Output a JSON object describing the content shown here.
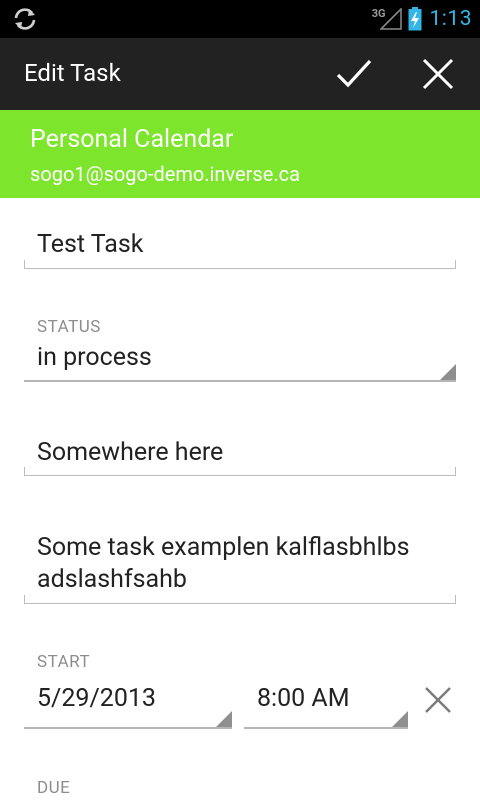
{
  "status_bar": {
    "network_type": "3G",
    "time": "1:13",
    "icons": [
      "sync-icon",
      "signal-icon",
      "battery-charging-icon"
    ]
  },
  "action_bar": {
    "title": "Edit Task",
    "confirm_icon": "checkmark-icon",
    "discard_icon": "close-icon"
  },
  "calendar": {
    "name": "Personal Calendar",
    "account": "sogo1@sogo-demo.inverse.ca",
    "color": "#7de52c"
  },
  "form": {
    "title_value": "Test Task",
    "status": {
      "label": "STATUS",
      "value": "in process"
    },
    "location_value": "Somewhere here",
    "description_line1": "Some task examplen kalflasbhlbs",
    "description_line2": "adslashfsahb",
    "start": {
      "label": "START",
      "date": "5/29/2013",
      "time": "8:00 AM",
      "clear_icon": "close-icon"
    },
    "due": {
      "label": "DUE"
    }
  },
  "accent_color": "#33b5e5"
}
